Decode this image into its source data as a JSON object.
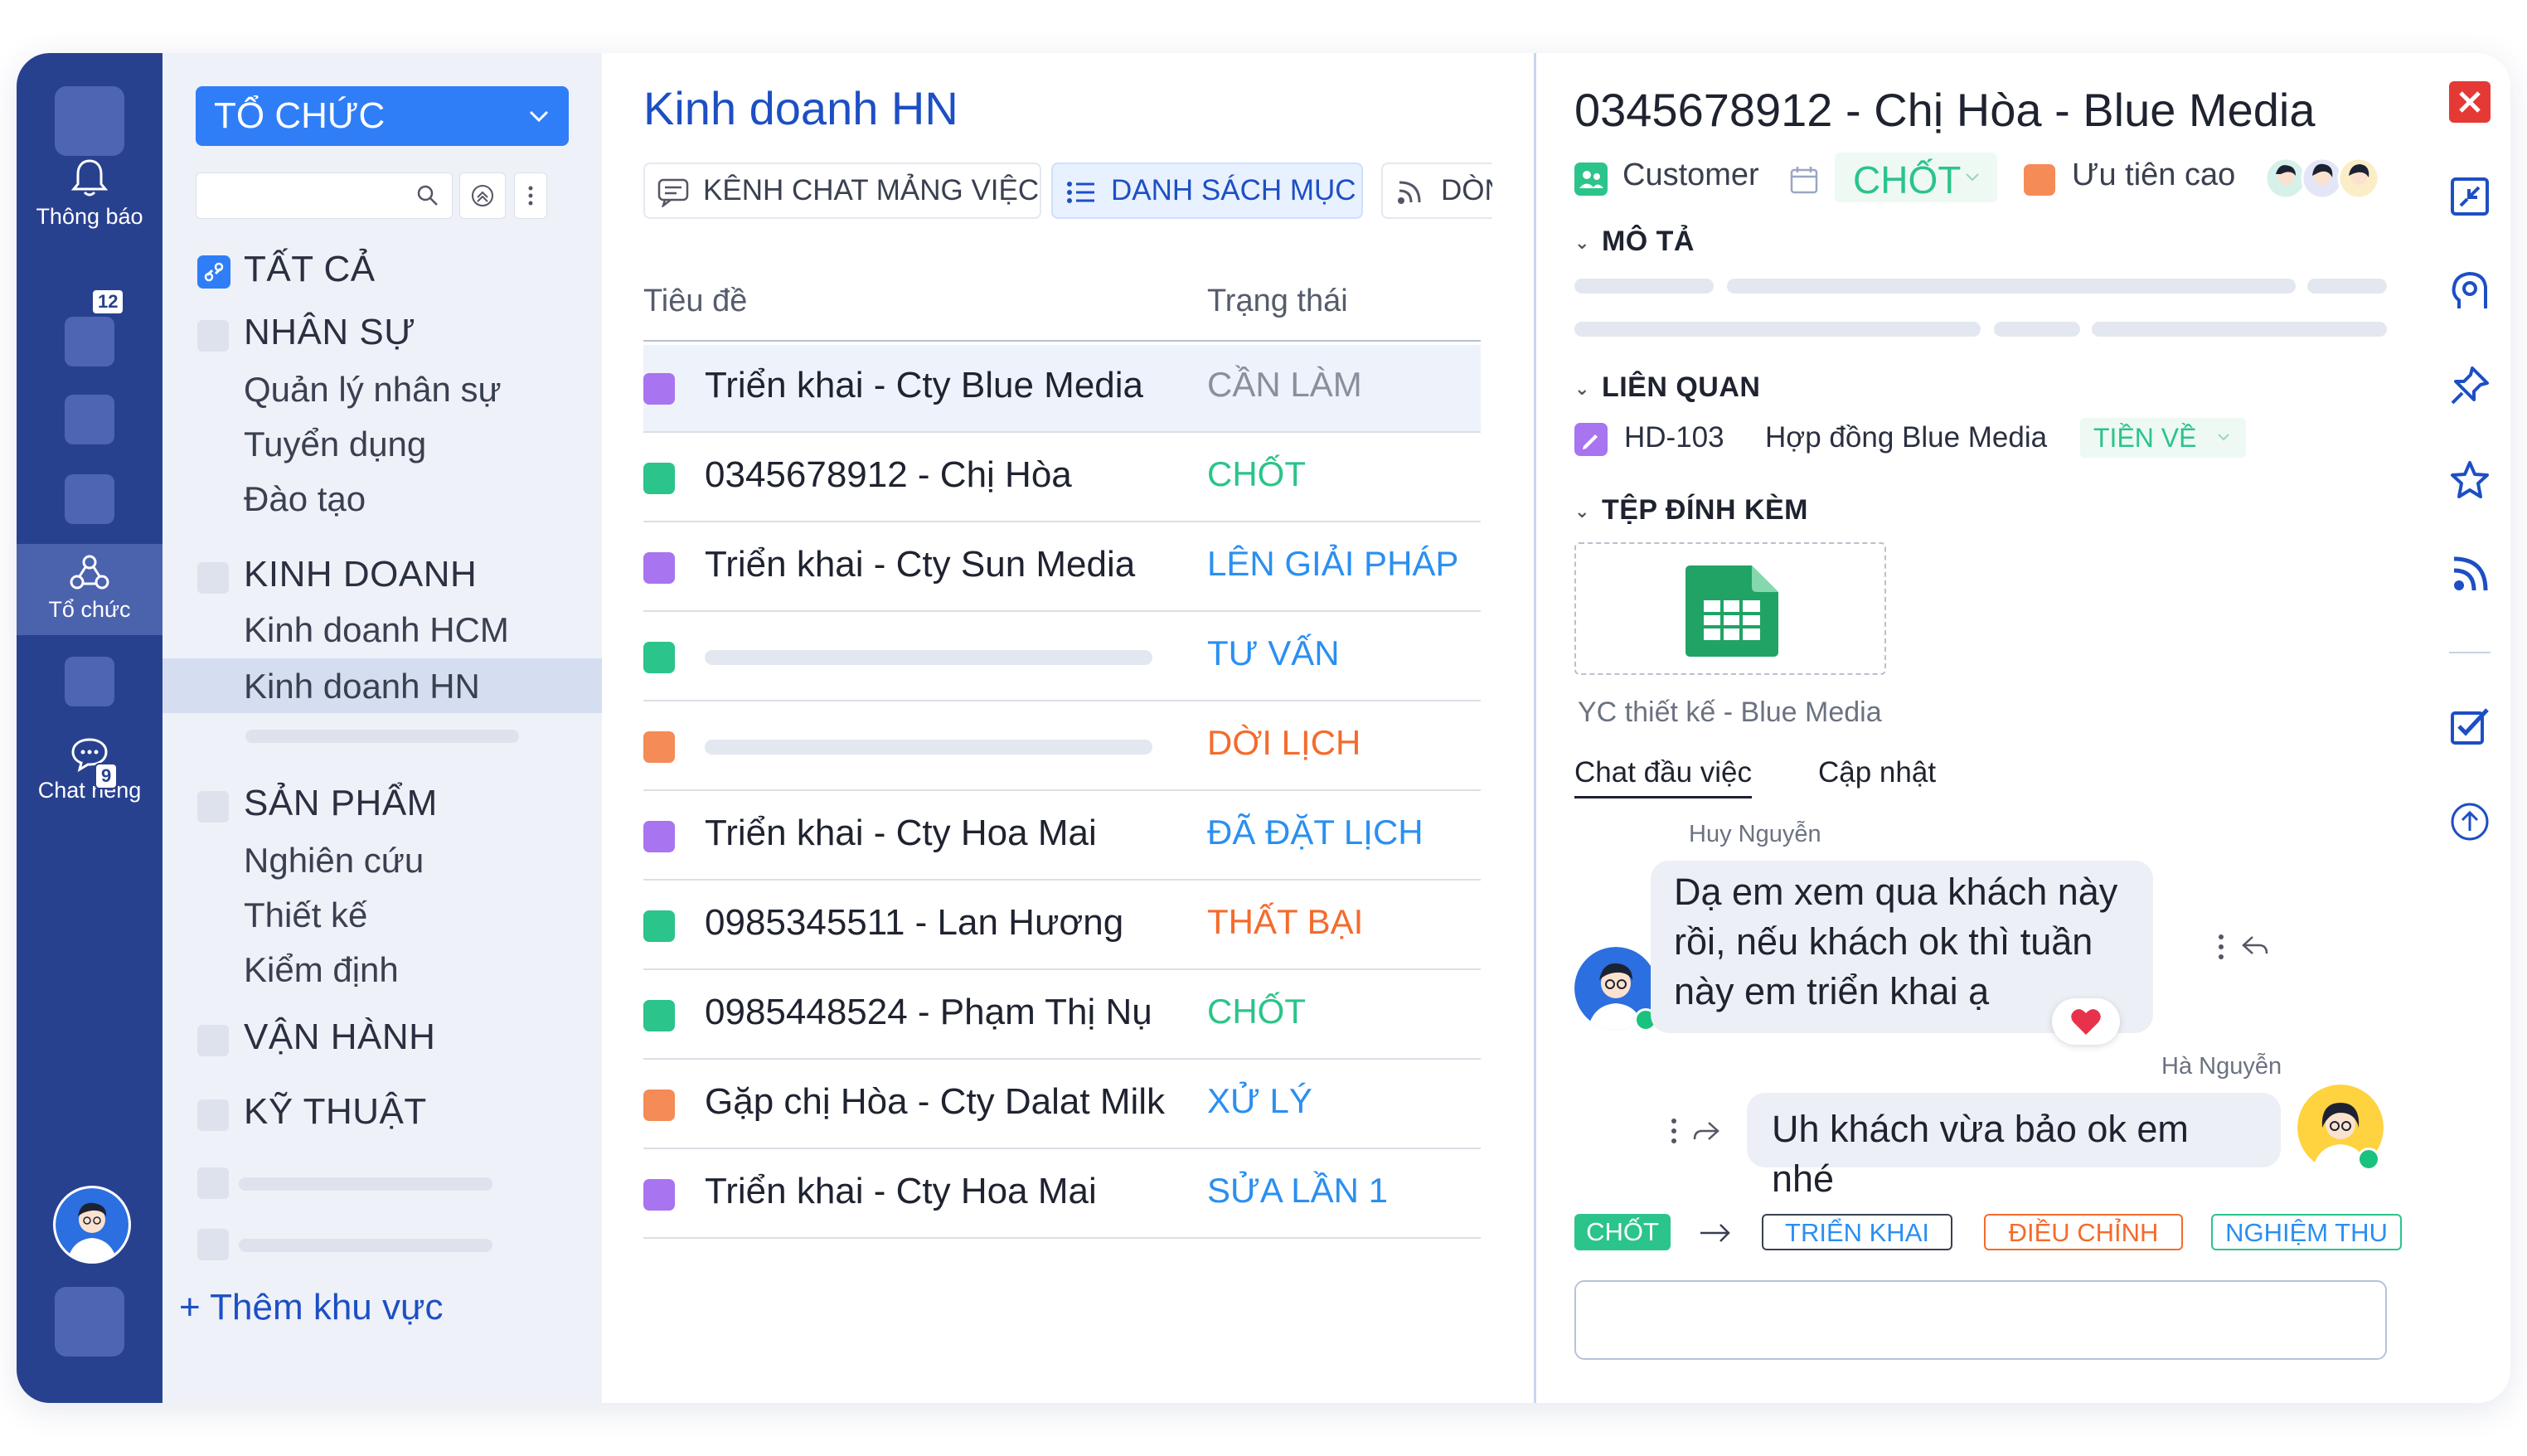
{
  "rail": {
    "notifications_label": "Thông báo",
    "notifications_count": "12",
    "org_label": "Tổ chức",
    "chat_label": "Chat riêng",
    "chat_count": "9"
  },
  "sidebar": {
    "org_select": "TỔ CHỨC",
    "all_label": "TẤT CẢ",
    "sections": [
      {
        "title": "NHÂN SỰ",
        "items": [
          "Quản lý nhân sự",
          "Tuyển dụng",
          "Đào tạo"
        ]
      },
      {
        "title": "KINH DOANH",
        "items": [
          "Kinh doanh HCM",
          "Kinh doanh HN"
        ]
      },
      {
        "title": "SẢN PHẨM",
        "items": [
          "Nghiên cứu",
          "Thiết kế",
          "Kiểm định"
        ]
      },
      {
        "title": "VẬN HÀNH",
        "items": []
      },
      {
        "title": "KỸ THUẬT",
        "items": []
      }
    ],
    "add_area": "+ Thêm khu vực"
  },
  "list": {
    "title": "Kinh doanh HN",
    "tabs": [
      "KÊNH CHAT MẢNG VIỆC",
      "DANH SÁCH MỤC",
      "DÒN"
    ],
    "col_title": "Tiêu đề",
    "col_status": "Trạng thái",
    "rows": [
      {
        "title": "Triển khai - Cty Blue Media",
        "status": "CẦN LÀM",
        "color": "#8a8f9c",
        "icon": "#a874f0"
      },
      {
        "title": "0345678912 - Chị Hòa",
        "status": "CHỐT",
        "color": "#2bc48a",
        "icon": "#2bc48a"
      },
      {
        "title": "Triển khai - Cty Sun Media",
        "status": "LÊN GIẢI PHÁP",
        "color": "#2b8ff0",
        "icon": "#a874f0"
      },
      {
        "title": "",
        "status": "TƯ VẤN",
        "color": "#2b8ff0",
        "icon": "#2bc48a"
      },
      {
        "title": "",
        "status": "DỜI LỊCH",
        "color": "#f46b2c",
        "icon": "#f58b57"
      },
      {
        "title": "Triển khai - Cty Hoa Mai",
        "status": "ĐÃ ĐẶT LỊCH",
        "color": "#2b8ff0",
        "icon": "#a874f0"
      },
      {
        "title": "0985345511 - Lan Hương",
        "status": "THẤT BẠI",
        "color": "#f46b2c",
        "icon": "#2bc48a"
      },
      {
        "title": "0985448524 - Phạm Thị Nụ",
        "status": "CHỐT",
        "color": "#2bc48a",
        "icon": "#2bc48a"
      },
      {
        "title": "Gặp chị Hòa - Cty Dalat Milk",
        "status": "XỬ LÝ",
        "color": "#2b8ff0",
        "icon": "#f58b57"
      },
      {
        "title": "Triển khai - Cty Hoa Mai",
        "status": "SỬA LẦN 1",
        "color": "#2b8ff0",
        "icon": "#a874f0"
      }
    ]
  },
  "detail": {
    "title": "0345678912 - Chị Hòa - Blue Media",
    "type_label": "Customer",
    "status": "CHỐT",
    "priority": "Ưu tiên cao",
    "desc_heading": "MÔ TẢ",
    "related_heading": "LIÊN QUAN",
    "related": {
      "code": "HD-103",
      "name": "Hợp đồng Blue Media",
      "status": "TIỀN VỀ"
    },
    "attach_heading": "TỆP ĐÍNH KÈM",
    "attachment_name": "YC thiết kế - Blue Media",
    "chat_tabs": [
      "Chat đầu việc",
      "Cập nhật"
    ],
    "messages": [
      {
        "author": "Huy Nguyễn",
        "text_lines": [
          "Dạ em xem qua khách này",
          "rồi, nếu khách ok thì tuần",
          "này em triển khai ạ"
        ]
      },
      {
        "author": "Hà Nguyễn",
        "text": "Uh khách vừa bảo ok em nhé"
      }
    ],
    "workflow": {
      "current": "CHỐT",
      "next": [
        "TRIỂN KHAI",
        "ĐIỀU CHỈNH",
        "NGHIỆM THU"
      ]
    }
  },
  "colors": {
    "rail": "#28418f",
    "accent_blue": "#1d4fc4",
    "green": "#2bc48a",
    "orange": "#f46b2c",
    "sky": "#2b8ff0"
  }
}
